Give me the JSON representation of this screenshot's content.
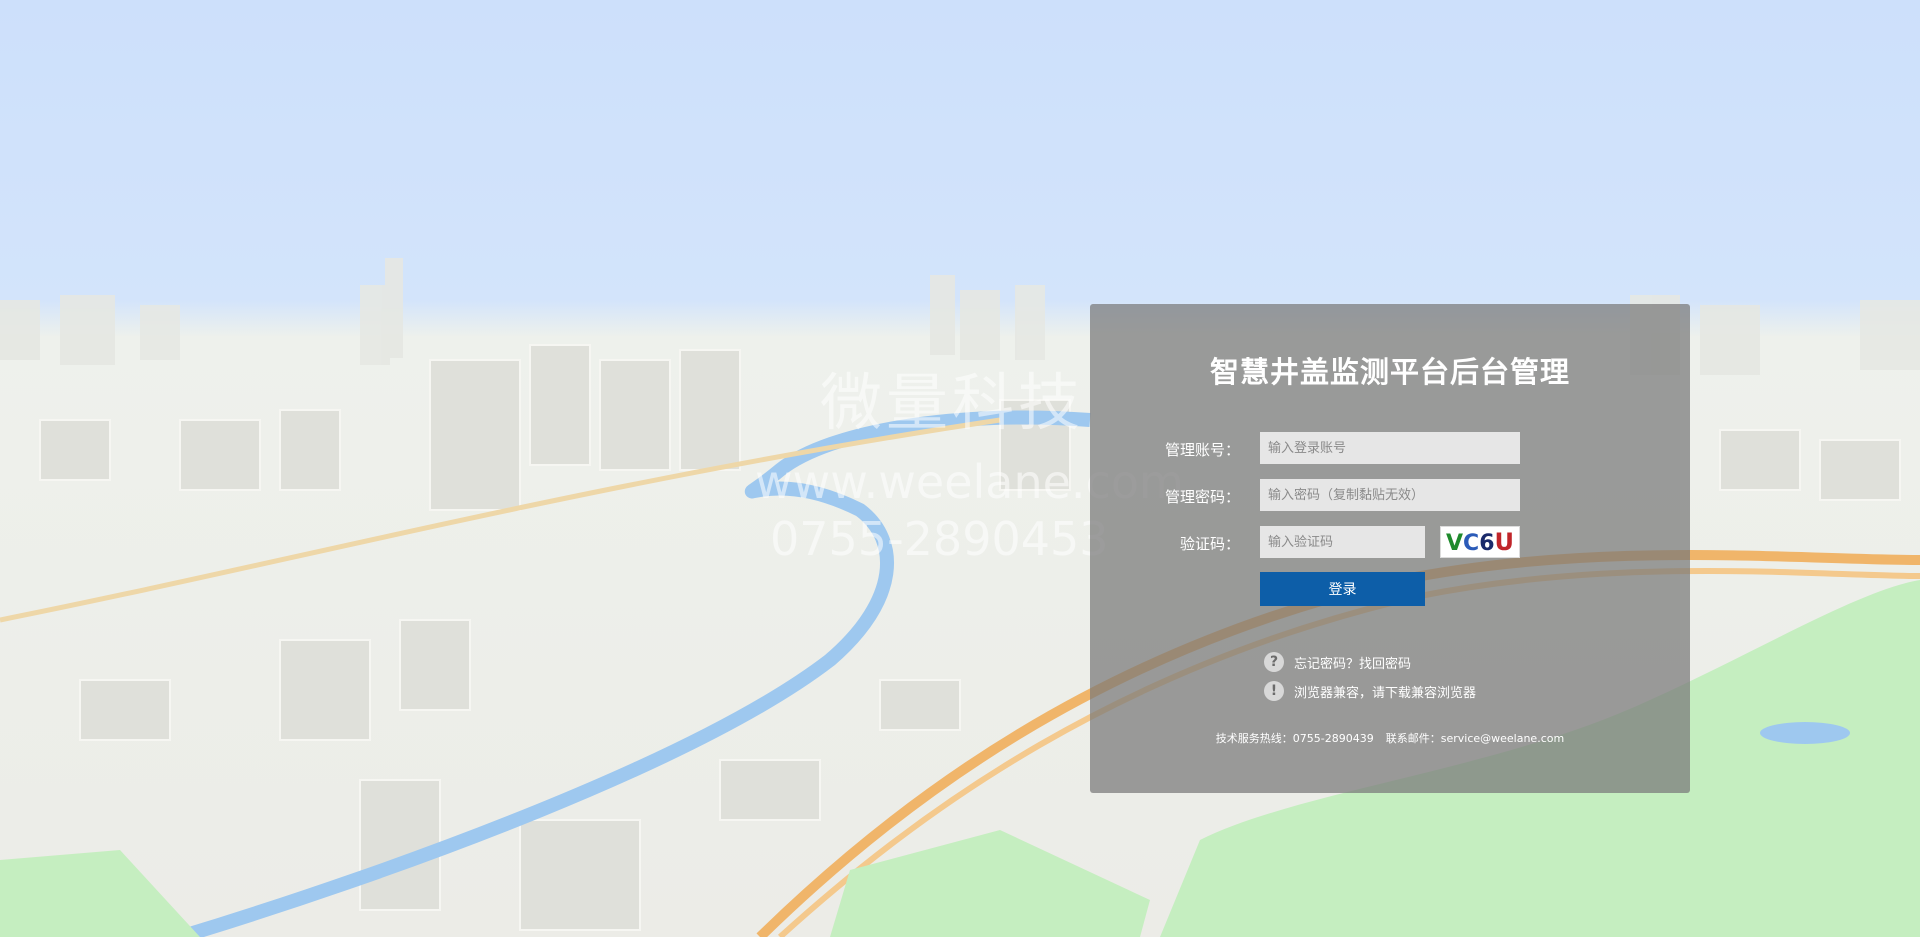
{
  "background": {
    "description_icon": "city-3d-map-background",
    "sky_color": "#cfe2fb",
    "map_color": "#eeeee9",
    "river_color": "#9ec8ef",
    "park_color": "#c5eec0",
    "road_color": "#f0b56a"
  },
  "watermark": {
    "line1": "微量科技",
    "line2": "www.weelane.com",
    "line3": "0755-2890453"
  },
  "login": {
    "title": "智慧井盖监测平台后台管理",
    "account_label": "管理账号：",
    "account_placeholder": "输入登录账号",
    "account_value": "",
    "password_label": "管理密码：",
    "password_placeholder": "输入密码（复制黏贴无效）",
    "password_value": "",
    "captcha_label": "验证码：",
    "captcha_placeholder": "输入验证码",
    "captcha_value": "",
    "captcha_chars": [
      "V",
      "C",
      "6",
      "U"
    ],
    "login_button": "登录",
    "forgot_password": "忘记密码？找回密码",
    "browser_notice": "浏览器兼容，请下载兼容浏览器",
    "hotline": "技术服务热线：0755-2890439",
    "email": "联系邮件：service@weelane.com",
    "help_icon_question": "?",
    "help_icon_exclaim": "!",
    "accent_color": "#0d5ea8"
  }
}
